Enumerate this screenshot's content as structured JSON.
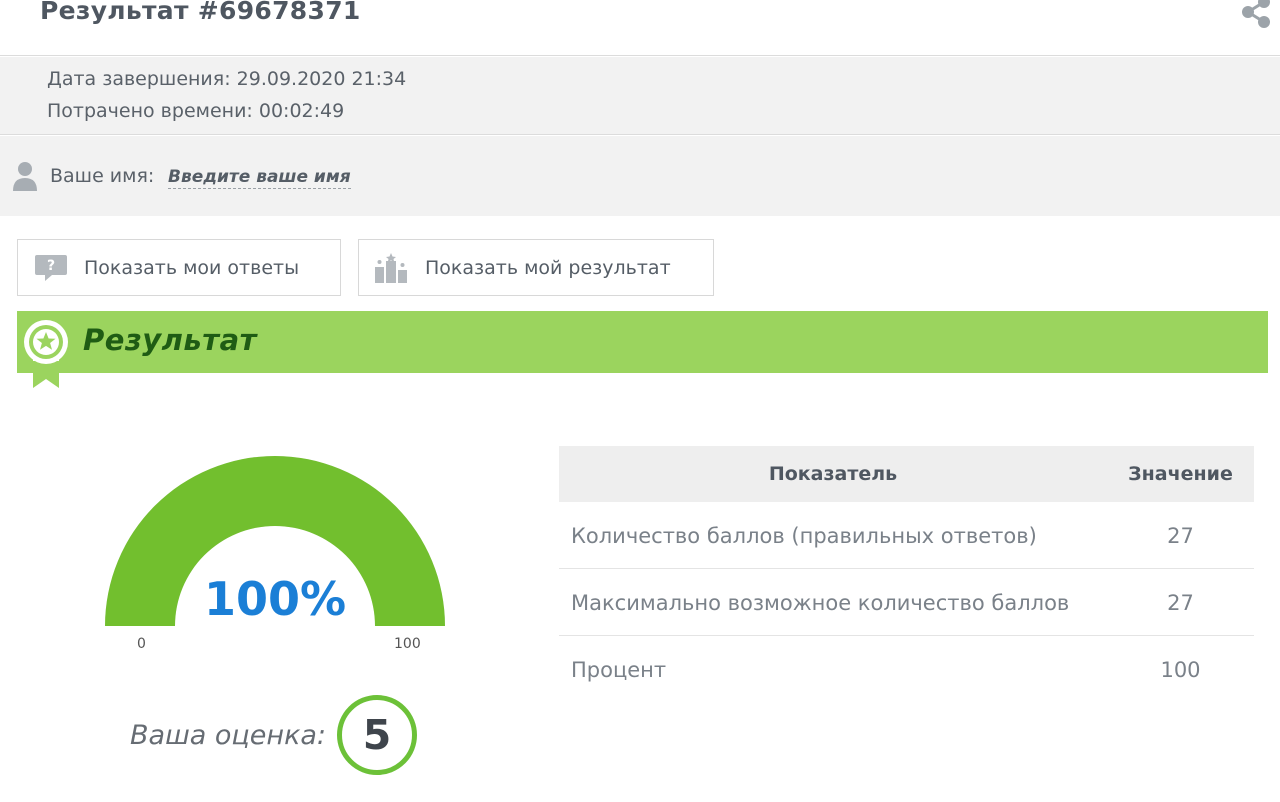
{
  "header": {
    "title": "Результат #69678371",
    "share_icon": "share-icon"
  },
  "meta": {
    "completion_date": "Дата завершения: 29.09.2020 21:34",
    "time_spent": "Потрачено времени: 00:02:49"
  },
  "user": {
    "name_label": "Ваше имя:",
    "name_link": "Введите ваше имя",
    "icon": "user-icon"
  },
  "buttons": {
    "show_answers": "Показать мои ответы",
    "show_result": "Показать мой результат"
  },
  "section": {
    "title": "Результат",
    "color": "#9bd45e",
    "title_color": "#1f5c14"
  },
  "gauge": {
    "percent": 100,
    "percent_label": "100%",
    "min_label": "0",
    "max_label": "100",
    "fill_color": "#72bf2e",
    "text_color": "#1b7fd6"
  },
  "grade": {
    "label": "Ваша оценка:",
    "value": "5",
    "ring_color": "#6cc138"
  },
  "table": {
    "headers": [
      "Показатель",
      "Значение"
    ],
    "rows": [
      {
        "name": "Количество баллов (правильных ответов)",
        "value": "27"
      },
      {
        "name": "Максимально возможное количество баллов",
        "value": "27"
      },
      {
        "name": "Процент",
        "value": "100"
      }
    ]
  }
}
